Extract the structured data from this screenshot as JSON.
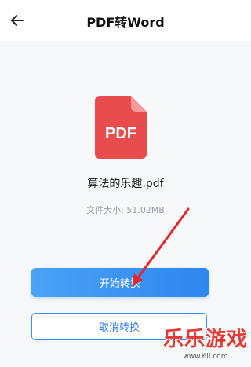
{
  "header": {
    "title": "PDF转Word",
    "back_icon": "arrow-left-icon"
  },
  "file": {
    "icon": "pdf-file-icon",
    "icon_label": "PDF",
    "icon_color": "#e84c4c",
    "name": "算法的乐趣.pdf",
    "size_label": "文件大小: 51.02MB"
  },
  "actions": {
    "start_label": "开始转换",
    "cancel_label": "取消转换"
  },
  "annotation": {
    "arrow_color": "#e5262b"
  },
  "watermark": {
    "text": "乐乐游戏",
    "url": "www.6ll.com"
  }
}
